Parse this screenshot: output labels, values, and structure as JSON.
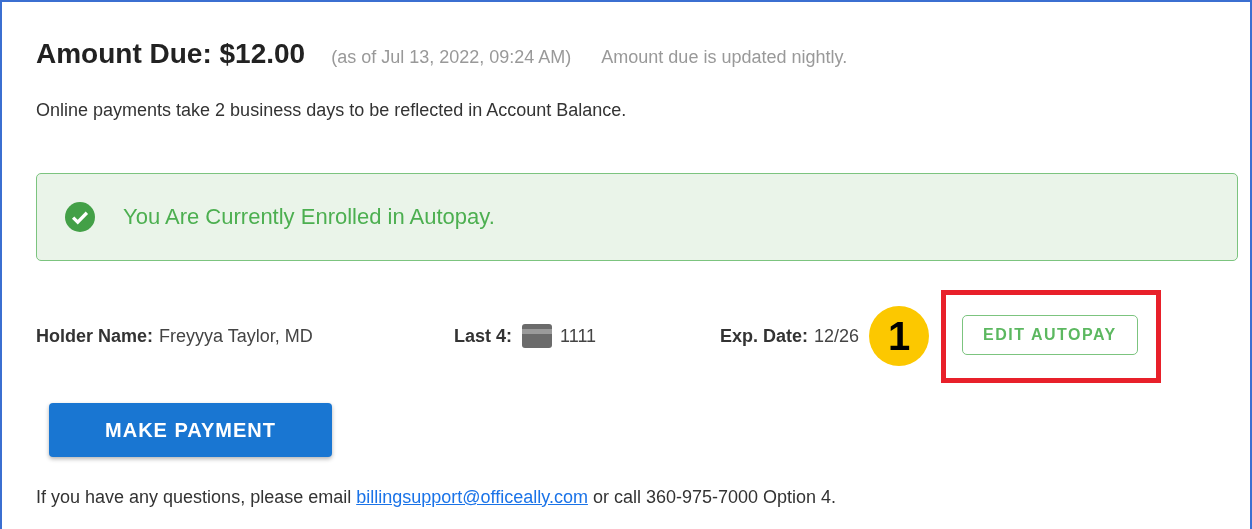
{
  "header": {
    "title": "Amount Due: $12.00",
    "as_of": "(as of Jul 13, 2022, 09:24 AM)",
    "note": "Amount due is updated nightly."
  },
  "info": "Online payments take 2 business days to be reflected in Account Balance.",
  "alert": {
    "kind": "success",
    "text": "You Are Currently Enrolled in Autopay."
  },
  "fields": [
    {
      "kind": "text",
      "label": "Holder Name:",
      "value": "Freyyya Taylor, MD"
    },
    {
      "kind": "card",
      "label": "Last 4:",
      "value": "1111"
    },
    {
      "kind": "text",
      "label": "Exp. Date:",
      "value": "12/26"
    }
  ],
  "callout": "1",
  "edit_button": {
    "label": "EDIT AUTOPAY",
    "highlighted": true
  },
  "pay_button": "MAKE PAYMENT",
  "footer": {
    "before": "If you have any questions, please email ",
    "link": "billingsupport@officeally.com",
    "after": " or call 360-975-7000 Option 4."
  }
}
